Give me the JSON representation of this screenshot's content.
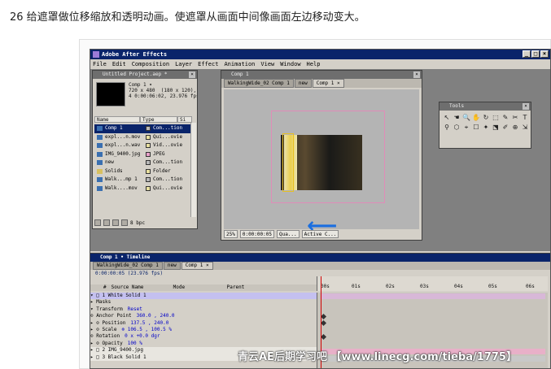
{
  "heading": "26 给遮罩做位移缩放和透明动画。使遮罩从画面中间像画面左边移动变大。",
  "app": {
    "title": "Adobe After Effects",
    "menu": [
      "File",
      "Edit",
      "Composition",
      "Layer",
      "Effect",
      "Animation",
      "View",
      "Window",
      "Help"
    ]
  },
  "project": {
    "title": "Untitled Project.aep *",
    "comp_name": "Comp 1 ▾",
    "info": "720 x 480  (180 x 120), D\n4 0:00:06:02, 23.976 fps",
    "columns": [
      "Name",
      "Type",
      "Si"
    ],
    "items": [
      {
        "name": "Comp 1",
        "type": "Com...tion",
        "color": "#b8b8b8"
      },
      {
        "name": "expl...n.mov",
        "type": "Qui...ovie",
        "color": "#e8e0a0"
      },
      {
        "name": "expl...n.wav",
        "type": "Vid...ovie",
        "color": "#e8e0a0"
      },
      {
        "name": "IMG_9400.jpg",
        "type": "JPEG",
        "color": "#e8a0c8"
      },
      {
        "name": "new",
        "type": "Com...tion",
        "color": "#b8b8b8"
      },
      {
        "name": "Solids",
        "type": "Folder",
        "color": "#e8e0a0"
      },
      {
        "name": "Walk...mp 1",
        "type": "Com...tion",
        "color": "#b8b8b8"
      },
      {
        "name": "Walk....mov",
        "type": "Qui...ovie",
        "color": "#e8e0a0"
      }
    ],
    "bpc": "8 bpc"
  },
  "comp": {
    "title": "Comp 1",
    "tabs": [
      "WalkingWide_02 Comp 1",
      "new",
      "Comp 1 ×"
    ],
    "zoom": "25%",
    "time": "0:00:00:05",
    "quality": "Qua...",
    "camera": "Active C..."
  },
  "tools": {
    "title": "Tools",
    "glyphs": [
      "↖",
      "☚",
      "🔍",
      "✋",
      "↻",
      "⬚",
      "✎",
      "✂",
      "T",
      "⚲",
      "⬡",
      "⌖",
      "☐",
      "✦",
      "⬔",
      "✐",
      "⊕",
      "⇲"
    ]
  },
  "timeline": {
    "title": "Comp 1 • Timeline",
    "tabs": [
      "WalkingWide_02 Comp 1",
      "new",
      "Comp 1 ×"
    ],
    "time": "0:00:00:05  (23.976 fps)",
    "columns": [
      "#",
      "Source Name",
      "Mode",
      "Parent"
    ],
    "rows": [
      {
        "name": "▾ □ 1   White Solid 1",
        "value": "",
        "kind": "sel"
      },
      {
        "name": "   ▸ Masks",
        "value": "",
        "kind": ""
      },
      {
        "name": "   ▾ Transform",
        "value": "Reset",
        "kind": ""
      },
      {
        "name": "       ⊙ Anchor Point",
        "value": "360.0 , 240.0",
        "kind": ""
      },
      {
        "name": "     ▸ ⊙ Position",
        "value": "137.5 , 240.0",
        "kind": ""
      },
      {
        "name": "     ▸ ⊙ Scale",
        "value": "⊗ 106.5 , 100.5 %",
        "kind": ""
      },
      {
        "name": "       ⊙ Rotation",
        "value": "0 x +0.0 dgr",
        "kind": ""
      },
      {
        "name": "     ▸ ⊙ Opacity",
        "value": "100 %",
        "kind": ""
      },
      {
        "name": "▸ □ 2   IMG_9400.jpg",
        "value": "",
        "kind": "layer"
      },
      {
        "name": "▸ □ 3   Black Solid 1",
        "value": "",
        "kind": "layer"
      }
    ],
    "ticks": [
      "00s",
      "01s",
      "02s",
      "03s",
      "04s",
      "05s",
      "06s"
    ]
  },
  "watermark": "青云AE后期学习吧 【www.linecg.com/tieba/1775】",
  "colors": {
    "accent": "#0a246a",
    "arrow": "#1a6ee0",
    "mask": "#e08cb8"
  }
}
